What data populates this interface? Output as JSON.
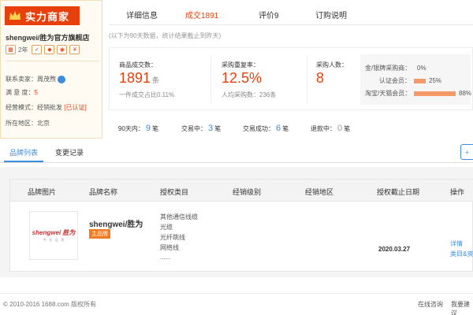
{
  "shop": {
    "badge_label": "实力商家",
    "name": "shengwei/胜为官方旗舰店",
    "years": "2年",
    "contact_label": "联系卖家：",
    "contact_name": "周茂煦",
    "satisfaction_label": "满 意 度：",
    "satisfaction_value": "5",
    "mode_label": "经营模式：",
    "mode_value": "经销批发",
    "certified": "[已认证]",
    "region_label": "所在地区：",
    "region_value": "北京"
  },
  "top_tabs": [
    "详细信息",
    "成交1891",
    "评价9",
    "订购说明"
  ],
  "active_top_tab": 1,
  "note": "(以下为90天数据，统计结果截止到昨天)",
  "stats": {
    "orders_label": "商品成交数：",
    "orders_value": "1891",
    "orders_unit": "条",
    "orders_sub": "一件成交占比0.11%",
    "repurchase_label": "采购重复率：",
    "repurchase_value": "12.5%",
    "repurchase_sub": "人均采购数：236条",
    "buyers_label": "采购人数：",
    "buyers_value": "8"
  },
  "buyer_breakdown": [
    {
      "label": "金/银牌采购商：",
      "value": "0%",
      "fraction": 0.0
    },
    {
      "label": "认证会员：",
      "value": "25%",
      "fraction": 0.25
    },
    {
      "label": "淘宝/天猫会员：",
      "value": "88%",
      "fraction": 0.88
    }
  ],
  "deals": [
    {
      "label": "90天内：",
      "value": "9",
      "unit": "笔"
    },
    {
      "label": "交易中：",
      "value": "3",
      "unit": "笔"
    },
    {
      "label": "交易成功：",
      "value": "6",
      "unit": "笔"
    },
    {
      "label": "退款中：",
      "value": "0",
      "unit": "笔"
    }
  ],
  "brand_tabs": [
    "品牌列表",
    "变更记录"
  ],
  "add_button": "+",
  "table": {
    "headers": [
      "品牌图片",
      "品牌名称",
      "授权类目",
      "经销级别",
      "经销地区",
      "授权截止日期",
      "操作"
    ],
    "row": {
      "logo_text": "shengwei 胜为",
      "logo_sub": "专 · 业 · 品 · 质",
      "brand_name": "shengwei/胜为",
      "main_tag": "主品牌",
      "categories": [
        "其他通信线缆",
        "光缆",
        "光纤跳线",
        "网络线",
        "......"
      ],
      "deadline": "2020.03.27",
      "op_detail": "详情",
      "op_more": "类目&资"
    }
  },
  "footer": {
    "copyright": "© 2010-2016 1688.com 版权所有",
    "links": [
      "在线咨询",
      "我要建议"
    ]
  },
  "colors": {
    "accent": "#e8400c",
    "link": "#3b8de0",
    "tag": "#f47a20"
  }
}
